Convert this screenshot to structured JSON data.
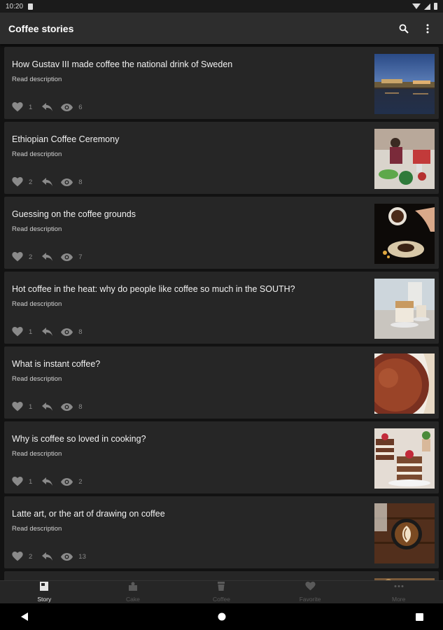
{
  "status_bar": {
    "time": "10:20"
  },
  "app_bar": {
    "title": "Coffee stories"
  },
  "stories": [
    {
      "title": "How Gustav III made coffee the national drink of Sweden",
      "subtitle": "Read description",
      "likes": "1",
      "views": "6"
    },
    {
      "title": "Ethiopian Coffee Ceremony",
      "subtitle": "Read description",
      "likes": "2",
      "views": "8"
    },
    {
      "title": "Guessing on the coffee grounds",
      "subtitle": "Read description",
      "likes": "2",
      "views": "7"
    },
    {
      "title": "Hot coffee in the heat: why do people like coffee so much in the SOUTH?",
      "subtitle": "Read description",
      "likes": "1",
      "views": "8"
    },
    {
      "title": "What is instant coffee?",
      "subtitle": "Read description",
      "likes": "1",
      "views": "8"
    },
    {
      "title": "Why is coffee so loved in cooking?",
      "subtitle": "Read description",
      "likes": "1",
      "views": "2"
    },
    {
      "title": "Latte art, or the art of drawing on coffee",
      "subtitle": "Read description",
      "likes": "2",
      "views": "13"
    }
  ],
  "bottom_nav": [
    {
      "label": "Story",
      "icon": "book-icon",
      "active": true
    },
    {
      "label": "Cake",
      "icon": "cake-icon",
      "active": false
    },
    {
      "label": "Coffee",
      "icon": "cup-icon",
      "active": false
    },
    {
      "label": "Favorite",
      "icon": "heart-icon",
      "active": false
    },
    {
      "label": "More",
      "icon": "more-horizontal-icon",
      "active": false
    }
  ],
  "colors": {
    "background": "#121212",
    "card": "#262626",
    "app_bar": "#2d2d2d",
    "stat_gray": "#8a8a8a"
  }
}
